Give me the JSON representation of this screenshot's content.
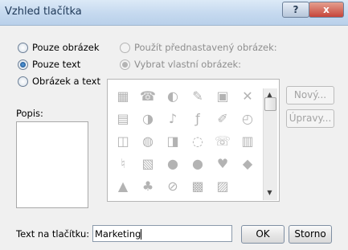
{
  "window": {
    "title": "Vzhled tlačítka",
    "help_button": "?",
    "close_button": "x"
  },
  "style_options": [
    {
      "label": "Pouze obrázek",
      "selected": false
    },
    {
      "label": "Pouze text",
      "selected": true
    },
    {
      "label": "Obrázek a text",
      "selected": false
    }
  ],
  "image_options": [
    {
      "label": "Použít přednastavený obrázek:",
      "selected": false,
      "enabled": false
    },
    {
      "label": "Vybrat vlastní obrázek:",
      "selected": true,
      "enabled": false
    }
  ],
  "description": {
    "label": "Popis:"
  },
  "buttons": {
    "new_label": "Nový...",
    "edit_label": "Úpravy...",
    "ok_label": "OK",
    "cancel_label": "Storno"
  },
  "button_text": {
    "label": "Text na tlačítku:",
    "value": "Marketing"
  },
  "icon_grid": [
    [
      "calculator-icon",
      "phone-icon",
      "speaker-waves-icon",
      "pencil-edit-icon",
      "save-icon",
      "close-x-icon"
    ],
    [
      "camera-icon",
      "sound-icon",
      "music-note-icon",
      "function-icon",
      "pencil-tool-icon",
      "gauge-icon"
    ],
    [
      "book-icon",
      "globe-icon",
      "tag-icon",
      "speech-bubble-icon",
      "telephone-icon",
      "trash-icon"
    ],
    [
      "bell-icon",
      "document-icon",
      "circle-icon",
      "circle-dark-icon",
      "heart-icon",
      "diamond-icon"
    ],
    [
      "triangle-icon",
      "club-icon",
      "no-entry-icon",
      "building-icon",
      "hatch-icon",
      "blank-icon"
    ]
  ]
}
